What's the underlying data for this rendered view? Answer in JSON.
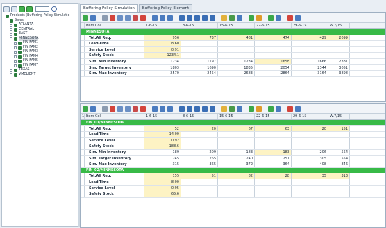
{
  "left_panel": {
    "combo_value": "",
    "tree": [
      {
        "label": "Products (Buffering Policy Simulatio",
        "level": 0,
        "expander": false,
        "selected": false
      },
      {
        "label": "Sales",
        "level": 1,
        "expander": false,
        "selected": false
      },
      {
        "label": "ATLANTA",
        "level": 2,
        "expander": true,
        "selected": false
      },
      {
        "label": "CENTRAL",
        "level": 2,
        "expander": true,
        "selected": false
      },
      {
        "label": "EAST",
        "level": 2,
        "expander": true,
        "selected": false
      },
      {
        "label": "MINNESOTA",
        "level": 2,
        "expander": true,
        "selected": true
      },
      {
        "label": "FIN FAM1",
        "level": 3,
        "expander": true,
        "selected": false
      },
      {
        "label": "FIN FAM2",
        "level": 3,
        "expander": true,
        "selected": false
      },
      {
        "label": "FIN FAM3",
        "level": 3,
        "expander": true,
        "selected": false
      },
      {
        "label": "FIN FAM4",
        "level": 3,
        "expander": true,
        "selected": false
      },
      {
        "label": "FIN FAM5",
        "level": 3,
        "expander": true,
        "selected": false
      },
      {
        "label": "FIN FAM7",
        "level": 3,
        "expander": true,
        "selected": false
      },
      {
        "label": "TEXAS",
        "level": 2,
        "expander": true,
        "selected": false
      },
      {
        "label": "VMCLIENT",
        "level": 2,
        "expander": true,
        "selected": false
      }
    ]
  },
  "tabs": [
    {
      "label": "Buffering Policy Simulation",
      "active": true
    },
    {
      "label": "Buffering Policy Element",
      "active": false
    }
  ],
  "columns": [
    "1",
    "Item Col",
    "1-6-15",
    "8-6-15",
    "15-6-15",
    "22-6-15",
    "29-6-15",
    "W.7/15"
  ],
  "panes": [
    {
      "rows": [
        {
          "type": "group",
          "cells": [
            "",
            "MINNESOTA",
            "",
            "",
            "",
            "",
            "",
            ""
          ]
        },
        {
          "type": "data",
          "cells": [
            "",
            "Tot.All Req.",
            "956",
            "737",
            "481",
            "474",
            "429",
            "2099"
          ],
          "hl": [
            2,
            3,
            4,
            5,
            6,
            7
          ]
        },
        {
          "type": "data",
          "cells": [
            "",
            "Lead-Time",
            "8.60",
            "",
            "",
            "",
            "",
            ""
          ],
          "hl": [
            2
          ]
        },
        {
          "type": "data",
          "cells": [
            "",
            "Service Level",
            "0.91",
            "",
            "",
            "",
            "",
            ""
          ],
          "hl": [
            2
          ]
        },
        {
          "type": "data",
          "cells": [
            "",
            "Safety Stock",
            "1234.1",
            "",
            "",
            "",
            "",
            ""
          ],
          "hl": [
            2
          ]
        },
        {
          "type": "data",
          "cells": [
            "",
            "Sim. Min Inventory",
            "1234",
            "1197",
            "1234",
            "1658",
            "1666",
            "2381"
          ],
          "hl": [
            5
          ]
        },
        {
          "type": "data",
          "cells": [
            "",
            "Sim. Target Inventory",
            "1803",
            "1690",
            "1835",
            "2054",
            "2344",
            "3051"
          ],
          "hl": []
        },
        {
          "type": "data",
          "cells": [
            "",
            "Sim. Max Inventory",
            "2570",
            "2454",
            "2683",
            "2864",
            "3164",
            "3898"
          ],
          "hl": []
        }
      ]
    },
    {
      "rows": [
        {
          "type": "group",
          "cells": [
            "",
            "FIN_01/MINNESOTA",
            "",
            "",
            "",
            "",
            "",
            ""
          ]
        },
        {
          "type": "data",
          "cells": [
            "",
            "Tot.All Req.",
            "52",
            "20",
            "67",
            "63",
            "20",
            "151"
          ],
          "hl": [
            2,
            3,
            4,
            5,
            6,
            7
          ]
        },
        {
          "type": "data",
          "cells": [
            "",
            "Lead-Time",
            "14.00",
            "",
            "",
            "",
            "",
            ""
          ],
          "hl": [
            2
          ]
        },
        {
          "type": "data",
          "cells": [
            "",
            "Service Level",
            "0.92",
            "",
            "",
            "",
            "",
            ""
          ],
          "hl": [
            2
          ]
        },
        {
          "type": "data",
          "cells": [
            "",
            "Safety Stock",
            "188.6",
            "",
            "",
            "",
            "",
            ""
          ],
          "hl": [
            2
          ]
        },
        {
          "type": "data",
          "cells": [
            "",
            "Sim. Min Inventory",
            "189",
            "209",
            "183",
            "183",
            "206",
            "554"
          ],
          "hl": [
            5
          ]
        },
        {
          "type": "data",
          "cells": [
            "",
            "Sim. Target Inventory",
            "245",
            "265",
            "240",
            "251",
            "305",
            "554"
          ],
          "hl": []
        },
        {
          "type": "data",
          "cells": [
            "",
            "Sim. Max Inventory",
            "315",
            "365",
            "372",
            "364",
            "408",
            "846"
          ],
          "hl": []
        },
        {
          "type": "group",
          "cells": [
            "",
            "FIN_02/MINNESOTA",
            "",
            "",
            "",
            "",
            "",
            ""
          ]
        },
        {
          "type": "data",
          "cells": [
            "",
            "Tot.All Req.",
            "155",
            "51",
            "82",
            "28",
            "35",
            "313"
          ],
          "hl": [
            2,
            3,
            4,
            5,
            6,
            7
          ]
        },
        {
          "type": "data",
          "cells": [
            "",
            "Lead-Time",
            "8.00",
            "",
            "",
            "",
            "",
            ""
          ],
          "hl": [
            2
          ]
        },
        {
          "type": "data",
          "cells": [
            "",
            "Service Level",
            "0.95",
            "",
            "",
            "",
            "",
            ""
          ],
          "hl": [
            2
          ]
        },
        {
          "type": "data",
          "cells": [
            "",
            "Safety Stock",
            "65.6",
            "",
            "",
            "",
            "",
            ""
          ],
          "hl": [
            2
          ]
        }
      ]
    }
  ],
  "icons": [
    "refresh-icon",
    "settings-icon",
    "undo-icon",
    "cut-icon",
    "copy-icon",
    "paste-icon",
    "save-icon",
    "delete-icon",
    "zoom-in-icon",
    "zoom-out-icon",
    "search-icon",
    "first-icon",
    "prev-icon",
    "play-icon",
    "next-icon",
    "last-icon",
    "filter-icon",
    "table-icon",
    "sigma-icon",
    "chart-icon",
    "color-icon",
    "align-icon",
    "options-icon",
    "link-icon",
    "export-icon"
  ]
}
